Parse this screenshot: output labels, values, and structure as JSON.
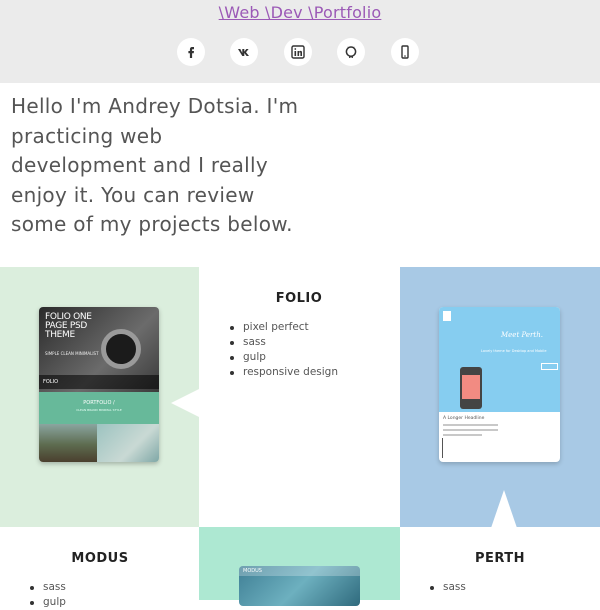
{
  "header": {
    "site_title": "\\Web \\Dev \\Portfolio",
    "social_links": [
      {
        "icon": "facebook-icon"
      },
      {
        "icon": "vk-icon"
      },
      {
        "icon": "linkedin-icon"
      },
      {
        "icon": "github-icon"
      },
      {
        "icon": "phone-icon"
      }
    ]
  },
  "intro": {
    "text": "Hello I'm Andrey Dotsia. I'm practicing web development and I really enjoy it. You can review some of my projects below."
  },
  "projects": {
    "folio": {
      "title": "FOLIO",
      "features": [
        "pixel perfect",
        "sass",
        "gulp",
        "responsive design"
      ],
      "thumb": {
        "headline": "FOLIO ONE PAGE PSD THEME",
        "tagline": "SIMPLE CLEAN MINIMALIST",
        "logo": "FOLIO",
        "banner_title": "PORTFOLIO /",
        "banner_sub": "CLEAN BRAND MINIMAL STYLE"
      }
    },
    "modus": {
      "title": "MODUS",
      "features": [
        "sass",
        "gulp"
      ],
      "thumb": {
        "logo": "MODUS"
      }
    },
    "perth": {
      "title": "PERTH",
      "features": [
        "sass"
      ],
      "thumb": {
        "script_title": "Meet Perth.",
        "subtitle": "Lovely theme for Desktop and Mobile",
        "section_heading": "A Longer Headline"
      }
    }
  },
  "colors": {
    "header_bg": "#ebebeb",
    "title_link": "#9b59b6",
    "folio_cell": "#dbeedd",
    "perth_cell": "#a8c9e5",
    "modus_cell": "#ade8d2"
  }
}
